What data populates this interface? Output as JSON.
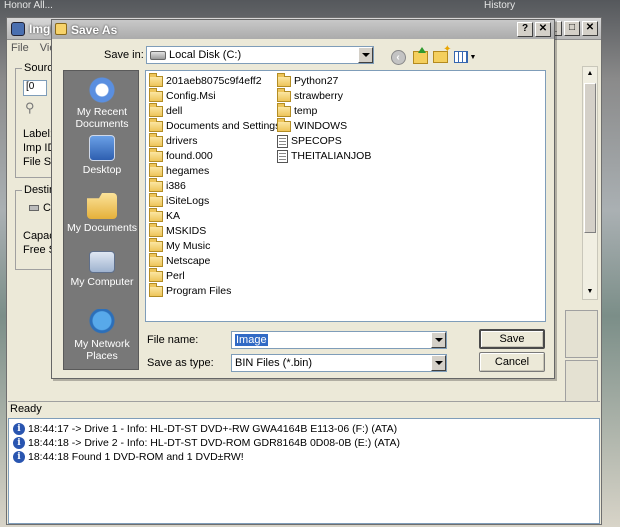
{
  "desktop": {
    "top_left": "Honor All...",
    "top_right": "History"
  },
  "app": {
    "title": "ImgB",
    "menu": [
      "File",
      "View"
    ],
    "source_label": "Source",
    "source_field": "[0",
    "label": "Label:",
    "imp_id": "Imp ID:",
    "file_sys": "File Sys",
    "destination_label": "Destina",
    "dest_item": "C",
    "capacity": "Capaci",
    "free_space": "Free Sp",
    "status": "Ready",
    "log": [
      "18:44:17 -> Drive 1 - Info: HL-DT-ST DVD+-RW GWA4164B E113-06 (F:) (ATA)",
      "18:44:18 -> Drive 2 - Info: HL-DT-ST DVD-ROM GDR8164B 0D08-0B (E:) (ATA)",
      "18:44:18 Found 1 DVD-ROM and 1 DVD±RW!"
    ]
  },
  "dialog": {
    "title": "Save As",
    "help_glyph": "?",
    "close_glyph": "✕",
    "save_in_label": "Save in:",
    "save_in_value": "Local Disk (C:)",
    "places": [
      {
        "icon": "my-recent-documents-icon",
        "label": "My Recent Documents"
      },
      {
        "icon": "desktop-icon",
        "label": "Desktop"
      },
      {
        "icon": "my-documents-icon",
        "label": "My Documents"
      },
      {
        "icon": "my-computer-icon",
        "label": "My Computer"
      },
      {
        "icon": "my-network-places-icon",
        "label": "My Network Places"
      }
    ],
    "files_col1": [
      "201aeb8075c9f4eff2",
      "Config.Msi",
      "dell",
      "Documents and Settings",
      "drivers",
      "found.000",
      "hegames",
      "i386",
      "iSiteLogs",
      "KA",
      "MSKIDS",
      "My Music",
      "Netscape",
      "Perl",
      "Program Files"
    ],
    "files_col2": [
      {
        "name": "Python27",
        "type": "folder"
      },
      {
        "name": "strawberry",
        "type": "folder"
      },
      {
        "name": "temp",
        "type": "folder"
      },
      {
        "name": "WINDOWS",
        "type": "folder"
      },
      {
        "name": "SPECOPS",
        "type": "file"
      },
      {
        "name": "THEITALIANJOB",
        "type": "file"
      }
    ],
    "file_name_label": "File name:",
    "file_name_value": "Image",
    "save_as_type_label": "Save as type:",
    "save_as_type_value": "BIN Files (*.bin)",
    "save_button": "Save",
    "cancel_button": "Cancel"
  }
}
